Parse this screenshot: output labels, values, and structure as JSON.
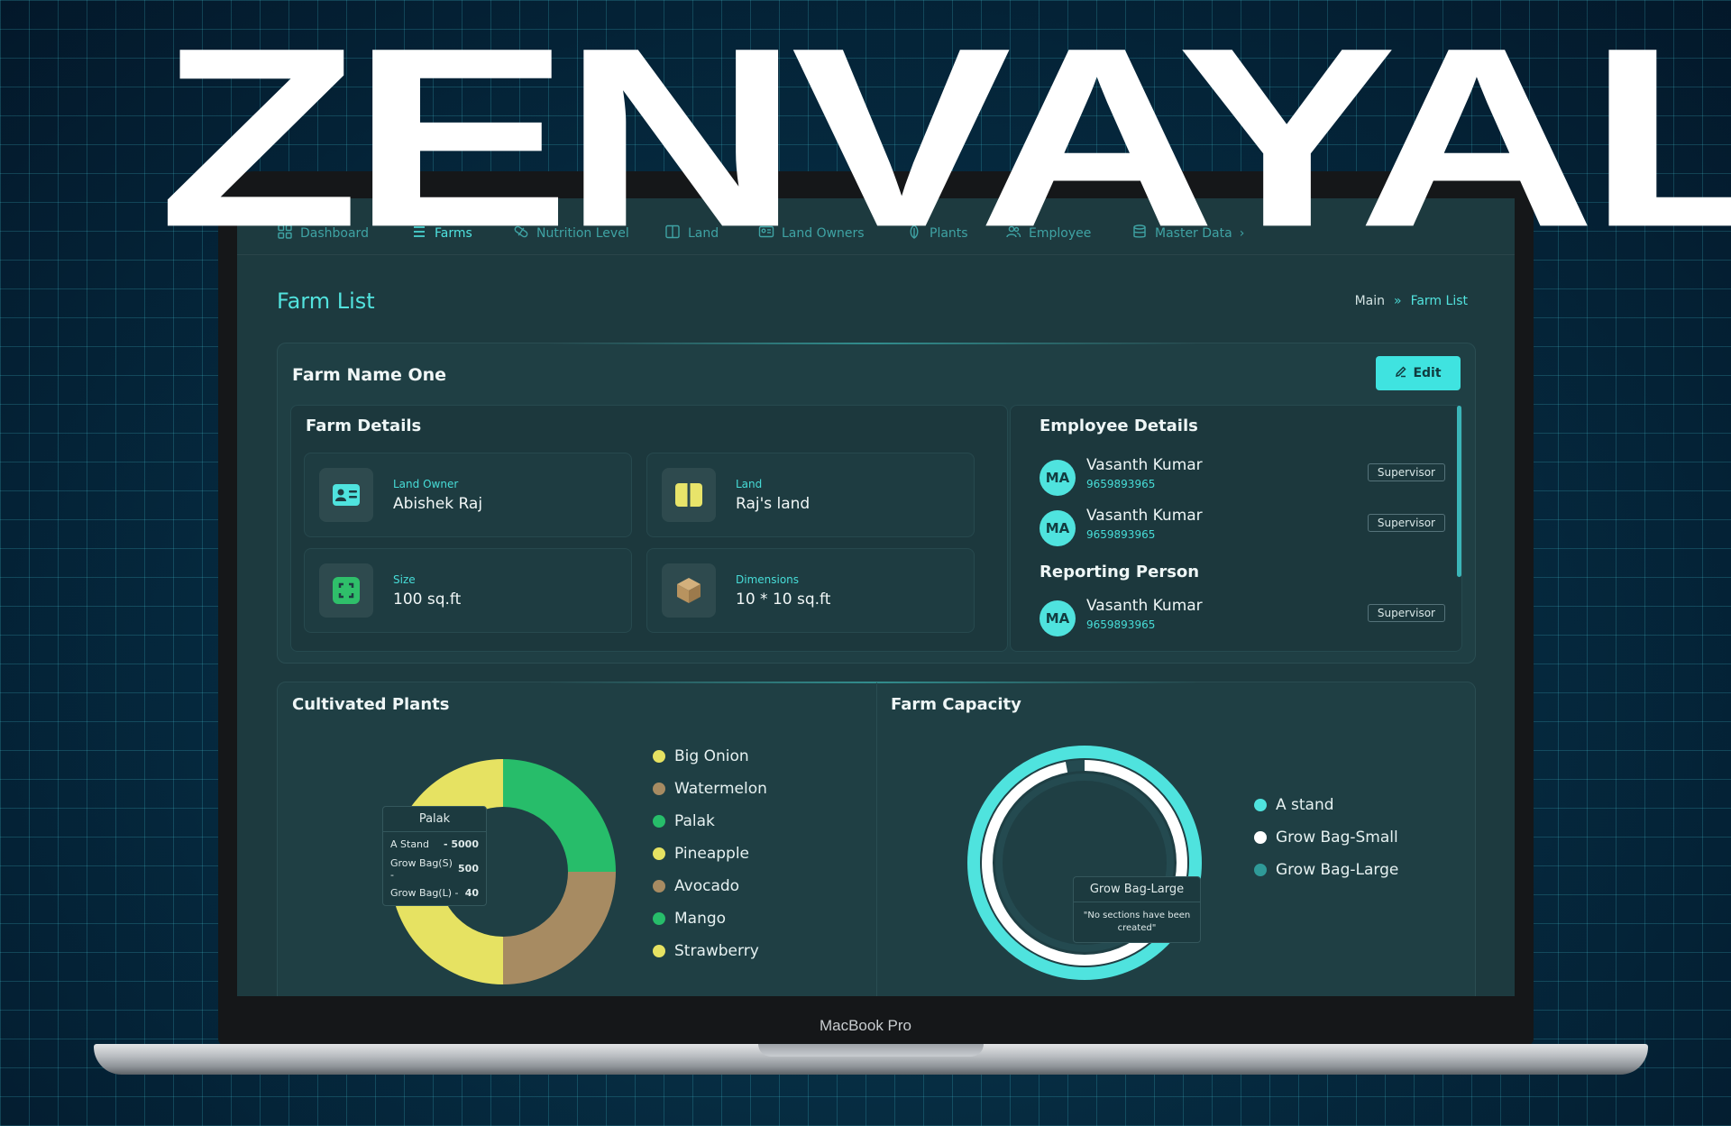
{
  "brand": "ZENVAYAL",
  "device_label": "MacBook Pro",
  "nav": [
    {
      "label": "Dashboard",
      "icon": "dashboard-icon",
      "active": false
    },
    {
      "label": "Farms",
      "icon": "list-icon",
      "active": true
    },
    {
      "label": "Nutrition Level",
      "icon": "pill-icon",
      "active": false
    },
    {
      "label": "Land",
      "icon": "book-icon",
      "active": false
    },
    {
      "label": "Land Owners",
      "icon": "id-card-icon",
      "active": false
    },
    {
      "label": "Plants",
      "icon": "leaf-icon",
      "active": false
    },
    {
      "label": "Employee",
      "icon": "users-icon",
      "active": false
    },
    {
      "label": "Master Data",
      "icon": "database-icon",
      "active": false
    }
  ],
  "page": {
    "title": "Farm List",
    "breadcrumb": [
      "Main",
      "Farm List"
    ],
    "breadcrumb_sep": "»"
  },
  "farm": {
    "name": "Farm Name One",
    "edit_label": "Edit",
    "details_title": "Farm Details",
    "details": [
      {
        "label": "Land Owner",
        "value": "Abishek Raj",
        "icon": "contact-card-icon",
        "color": "#4fe3de"
      },
      {
        "label": "Land",
        "value": "Raj's land",
        "icon": "book-icon",
        "color": "#e8e46a"
      },
      {
        "label": "Size",
        "value": "100 sq.ft",
        "icon": "frame-icon",
        "color": "#2fbf6a"
      },
      {
        "label": "Dimensions",
        "value": "10 * 10 sq.ft",
        "icon": "box-icon",
        "color": "#b8935f"
      }
    ]
  },
  "employees": {
    "title": "Employee Details",
    "list": [
      {
        "initials": "MA",
        "name": "Vasanth Kumar",
        "phone": "9659893965",
        "role": "Supervisor"
      },
      {
        "initials": "MA",
        "name": "Vasanth Kumar",
        "phone": "9659893965",
        "role": "Supervisor"
      }
    ],
    "reporting_title": "Reporting Person",
    "reporting": {
      "initials": "MA",
      "name": "Vasanth Kumar",
      "phone": "9659893965",
      "role": "Supervisor"
    }
  },
  "cultivated": {
    "title": "Cultivated Plants",
    "legend": [
      {
        "label": "Big Onion",
        "color": "#e6e262"
      },
      {
        "label": "Watermelon",
        "color": "#a78b62"
      },
      {
        "label": "Palak",
        "color": "#27bd6a"
      },
      {
        "label": "Pineapple",
        "color": "#e6e262"
      },
      {
        "label": "Avocado",
        "color": "#a78b62"
      },
      {
        "label": "Mango",
        "color": "#27bd6a"
      },
      {
        "label": "Strawberry",
        "color": "#e6e262"
      }
    ],
    "tooltip": {
      "title": "Palak",
      "rows": [
        {
          "label": "A  Stand",
          "value": "- 5000"
        },
        {
          "label": "Grow Bag(S) -",
          "value": "500"
        },
        {
          "label": "Grow Bag(L) -",
          "value": "40"
        }
      ]
    }
  },
  "capacity": {
    "title": "Farm Capacity",
    "legend": [
      {
        "label": "A stand",
        "color": "#4fe3de"
      },
      {
        "label": "Grow Bag-Small",
        "color": "#ffffff"
      },
      {
        "label": "Grow Bag-Large",
        "color": "#2f9a98"
      }
    ],
    "tooltip": {
      "title": "Grow Bag-Large",
      "text": "\"No sections have been created\""
    }
  },
  "chart_data": [
    {
      "type": "pie",
      "title": "Cultivated Plants",
      "categories": [
        "Palak",
        "Watermelon",
        "Big Onion"
      ],
      "values": [
        25,
        25,
        50
      ],
      "colors": [
        "#27bd6a",
        "#a78b62",
        "#e6e262"
      ]
    },
    {
      "type": "pie",
      "title": "Farm Capacity",
      "categories": [
        "A stand",
        "Grow Bag-Small",
        "Grow Bag-Large"
      ],
      "values": [
        100,
        97,
        0
      ],
      "colors": [
        "#4fe3de",
        "#ffffff",
        "#2f9a98"
      ]
    }
  ]
}
